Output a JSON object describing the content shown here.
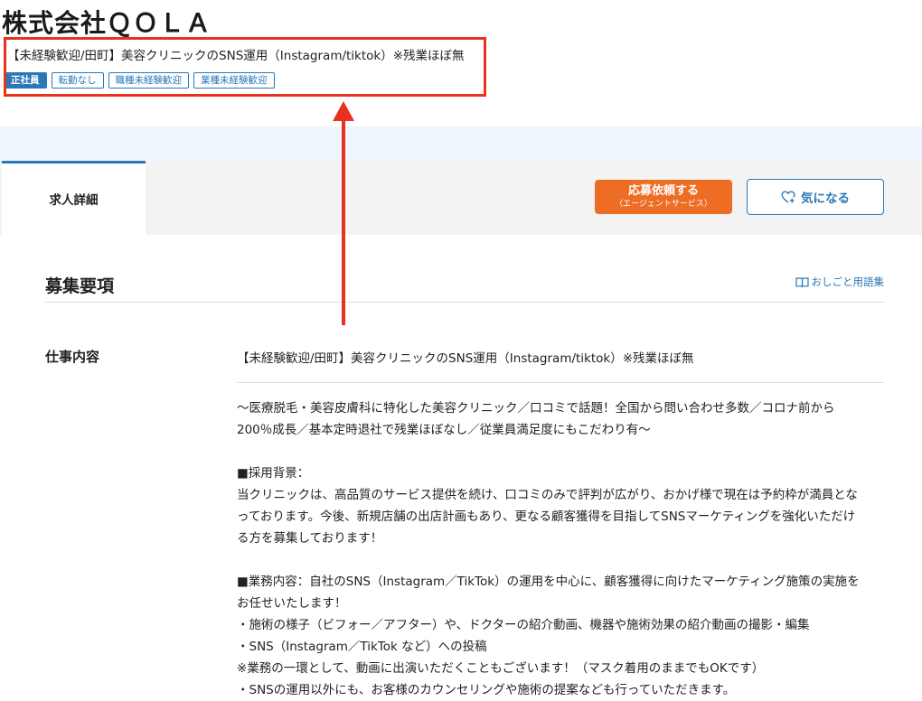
{
  "company": {
    "name": "株式会社ＱＯＬＡ"
  },
  "job": {
    "title": "【未経験歓迎/田町】美容クリニックのSNS運用（Instagram/tiktok）※残業ほぼ無",
    "tags": [
      "正社員",
      "転勤なし",
      "職種未経験歓迎",
      "業種未経験歓迎"
    ]
  },
  "tabs": [
    {
      "label": "求人詳細"
    }
  ],
  "actions": {
    "apply_main": "応募依頼する",
    "apply_sub": "（エージェントサービス）",
    "favorite": "気になる"
  },
  "section": {
    "title": "募集要項",
    "glossary_link": "おしごと用語集"
  },
  "job_details": {
    "label": "仕事内容",
    "headline": "【未経験歓迎/田町】美容クリニックのSNS運用（Instagram/tiktok）※残業ほぼ無",
    "lines": [
      "〜医療脱毛・美容皮膚科に特化した美容クリニック／口コミで話題！全国から問い合わせ多数／コロナ前から",
      "200％成長／基本定時退社で残業ほぼなし／従業員満足度にもこだわり有〜",
      "",
      "■採用背景：",
      "当クリニックは、高品質のサービス提供を続け、口コミのみで評判が広がり、おかげ様で現在は予約枠が満員とな",
      "っております。今後、新規店舗の出店計画もあり、更なる顧客獲得を目指してSNSマーケティングを強化いただけ",
      "る方を募集しております！",
      "",
      "■業務内容：自社のSNS（Instagram／TikTok）の運用を中心に、顧客獲得に向けたマーケティング施策の実施を",
      "お任せいたします！",
      "・施術の様子（ビフォー／アフター）や、ドクターの紹介動画、機器や施術効果の紹介動画の撮影・編集",
      "・SNS（Instagram／TikTok など）への投稿",
      "※業務の一環として、動画に出演いただくこともございます！（マスク着用のままでもOKです）",
      "・SNSの運用以外にも、お客様のカウンセリングや施術の提案なども行っていただきます。"
    ]
  },
  "colors": {
    "accent_blue": "#2a78b9",
    "apply_orange": "#ee6d25",
    "annotation_red": "#e8321e",
    "band_blue": "#eef5fc"
  }
}
